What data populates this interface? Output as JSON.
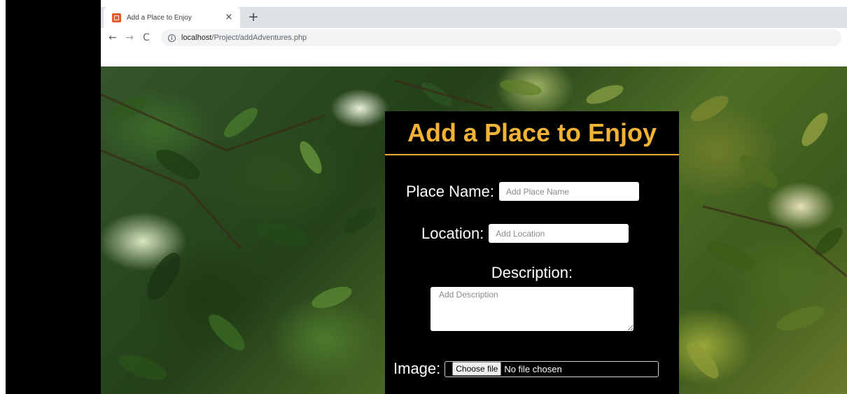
{
  "browser": {
    "tab_title": "Add a Place to Enjoy",
    "tab_close": "×",
    "new_tab": "+",
    "nav": {
      "back": "←",
      "forward": "→",
      "reload": "C"
    },
    "url_host": "localhost",
    "url_path": "/Project/addAdventures.php"
  },
  "form": {
    "title": "Add a Place to Enjoy",
    "place_name": {
      "label": "Place Name:",
      "placeholder": "Add Place Name"
    },
    "location": {
      "label": "Location:",
      "placeholder": "Add Location"
    },
    "description": {
      "label": "Description:",
      "placeholder": "Add Description"
    },
    "image": {
      "label": "Image:",
      "button": "Choose file",
      "status": "No file chosen"
    }
  },
  "colors": {
    "accent": "#f2b234",
    "panel_bg": "#000000",
    "favicon": "#e85a2e"
  },
  "icons": {
    "favicon": "page-favicon",
    "info": "info-icon"
  }
}
